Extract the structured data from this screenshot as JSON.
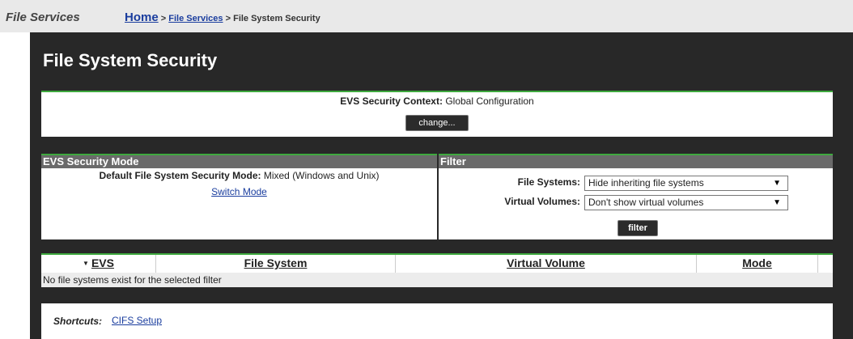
{
  "topbar": {
    "section": "File Services",
    "home": "Home",
    "sep": ">",
    "crumb_file_services": "File Services",
    "crumb_current": "File System Security"
  },
  "page": {
    "title": "File System Security"
  },
  "context": {
    "label": "EVS Security Context:",
    "value": "Global Configuration",
    "change_button": "change..."
  },
  "mode_panel": {
    "title": "EVS Security Mode",
    "label": "Default File System Security Mode:",
    "value": "Mixed (Windows and Unix)",
    "switch_link": "Switch Mode"
  },
  "filter_panel": {
    "title": "Filter",
    "fs_label": "File Systems:",
    "fs_selected": "Hide inheriting file systems",
    "vv_label": "Virtual Volumes:",
    "vv_selected": "Don't show virtual volumes",
    "filter_button": "filter"
  },
  "table": {
    "columns": [
      "EVS",
      "File System",
      "Virtual Volume",
      "Mode"
    ],
    "empty_message": "No file systems exist for the selected filter"
  },
  "shortcuts": {
    "label": "Shortcuts:",
    "links": [
      "CIFS Setup"
    ]
  },
  "icons": {
    "sort": "sort-desc-icon",
    "dropdown": "dropdown-arrow-icon"
  },
  "colors": {
    "accent_green": "#3ea93e",
    "link_blue": "#1a3d9e",
    "panel_header": "#6a6a6a",
    "background_dark": "#282828"
  }
}
